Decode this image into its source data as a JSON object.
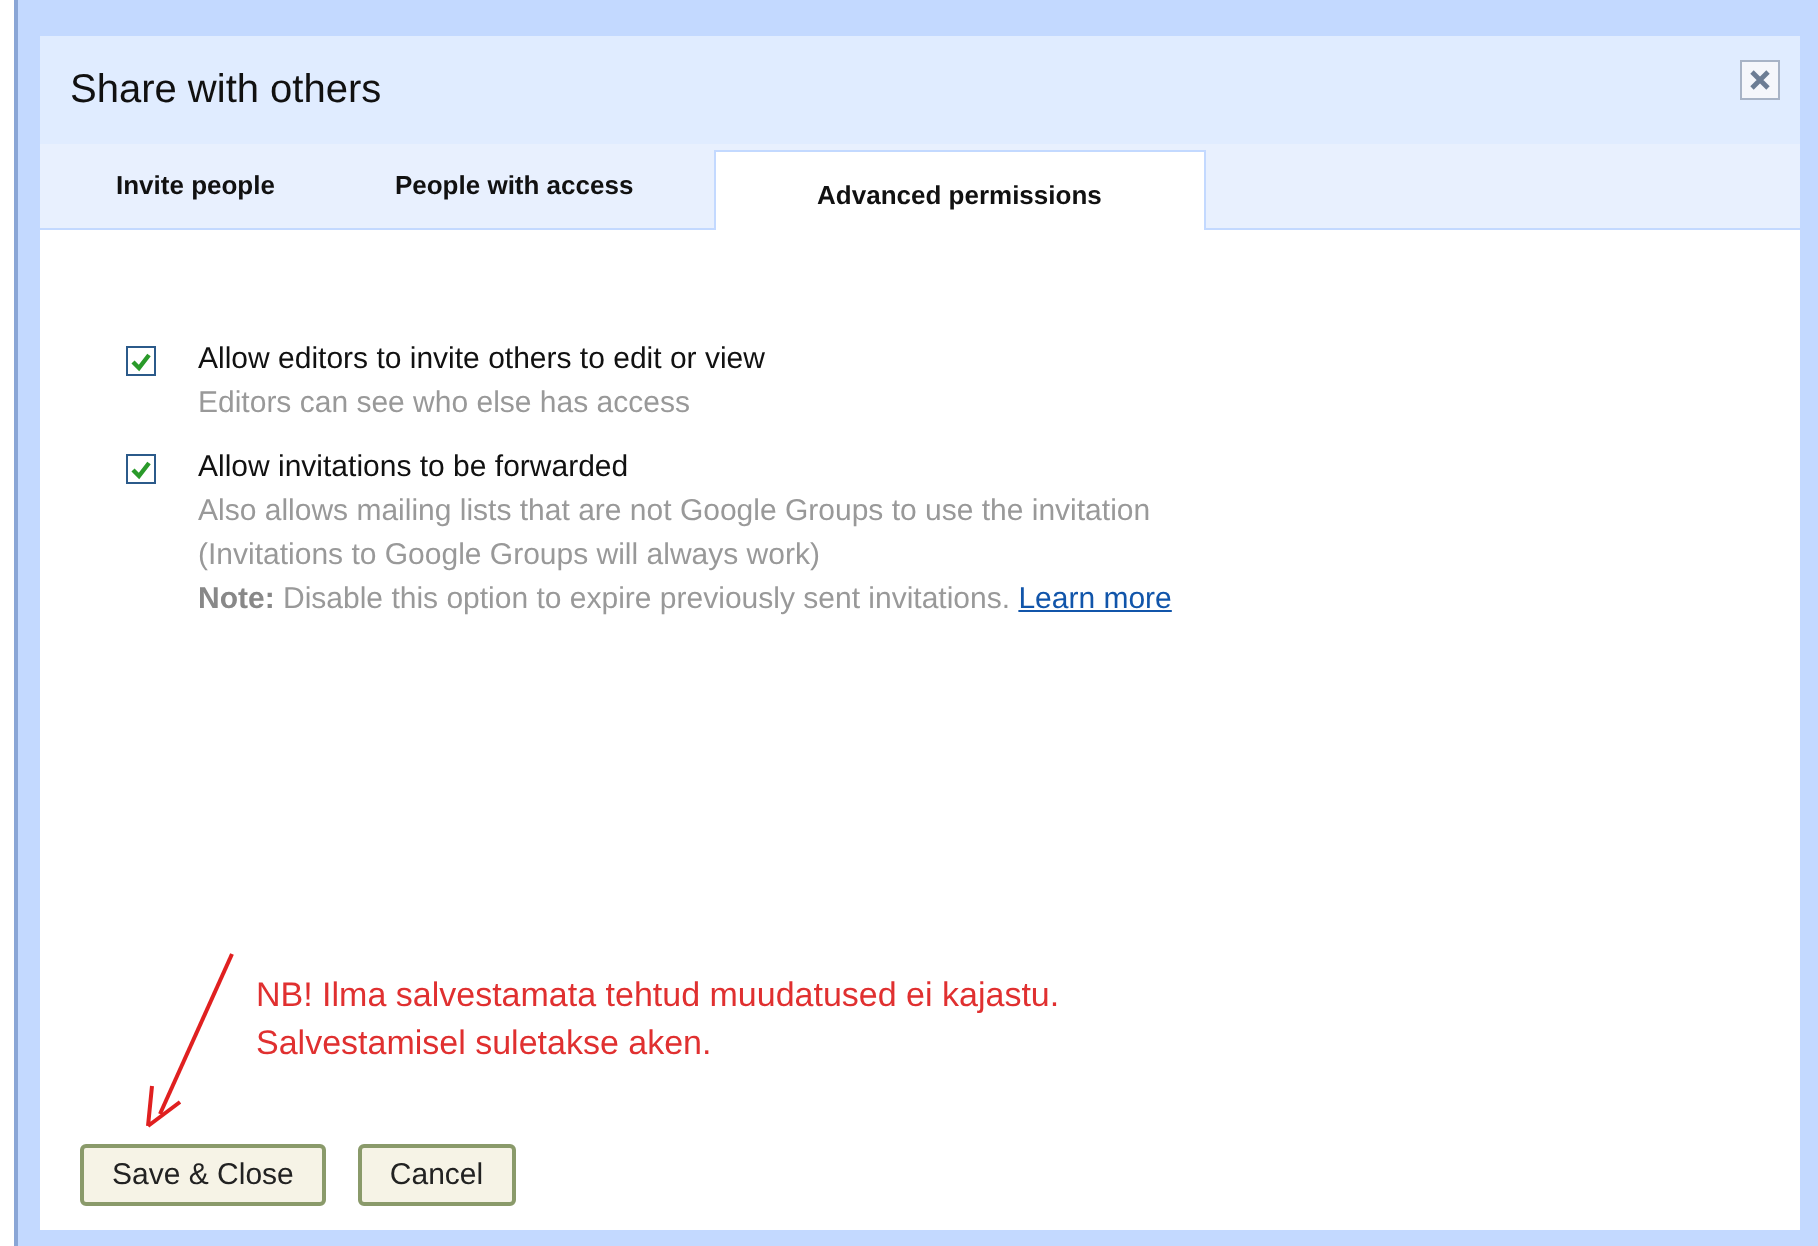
{
  "dialog": {
    "title": "Share with others"
  },
  "tabs": [
    {
      "label": "Invite people",
      "selected": false
    },
    {
      "label": "People with access",
      "selected": false
    },
    {
      "label": "Advanced permissions",
      "selected": true
    }
  ],
  "options": [
    {
      "label": "Allow editors to invite others to edit or view",
      "checked": true,
      "description": [
        "Editors can see who else has access"
      ]
    },
    {
      "label": "Allow invitations to be forwarded",
      "checked": true,
      "description": [
        "Also allows mailing lists that are not Google Groups to use the invitation",
        "(Invitations to Google Groups will always work)"
      ],
      "note": "**Note:** Disable this option to expire previously sent invitations.",
      "link": "Learn more"
    }
  ],
  "annotation": [
    "NB! Ilma salvestamata tehtud muudatused ei kajastu.",
    "Salvestamisel suletakse aken."
  ],
  "buttons": [
    "Save & Close",
    "Cancel"
  ]
}
